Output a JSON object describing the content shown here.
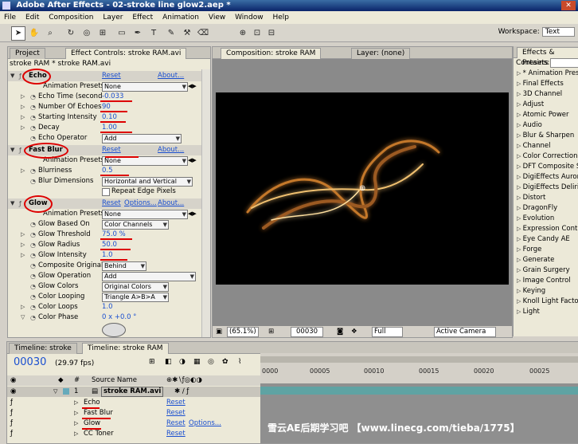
{
  "app": {
    "title": "Adobe After Effects - 02-stroke line glow2.aep *"
  },
  "menu": [
    "File",
    "Edit",
    "Composition",
    "Layer",
    "Effect",
    "Animation",
    "View",
    "Window",
    "Help"
  ],
  "toolbar": {
    "workspace_label": "Workspace:",
    "workspace_value": "Text"
  },
  "effect_controls": {
    "tabs": [
      "Project",
      "Effect Controls: stroke RAM.avi"
    ],
    "subtitle": "stroke RAM * stroke RAM.avi",
    "reset_label": "Reset",
    "about_label": "About...",
    "options_label": "Options...",
    "echo": {
      "name": "Echo",
      "animation_presets_label": "Animation Presets:",
      "animation_presets_value": "None",
      "props": [
        {
          "label": "Echo Time (second",
          "value": "-0.033"
        },
        {
          "label": "Number Of Echoes",
          "value": "90"
        },
        {
          "label": "Starting Intensity",
          "value": "0.10"
        },
        {
          "label": "Decay",
          "value": "1.00"
        }
      ],
      "operator_label": "Echo Operator",
      "operator_value": "Add"
    },
    "fast_blur": {
      "name": "Fast Blur",
      "animation_presets_label": "Animation Presets:",
      "animation_presets_value": "None",
      "blurriness_label": "Blurriness",
      "blurriness_value": "0.5",
      "dimensions_label": "Blur Dimensions",
      "dimensions_value": "Horizontal and Vertical",
      "repeat_label": "Repeat Edge Pixels"
    },
    "glow": {
      "name": "Glow",
      "animation_presets_label": "Animation Presets:",
      "animation_presets_value": "None",
      "based_on_label": "Glow Based On",
      "based_on_value": "Color Channels",
      "threshold_label": "Glow Threshold",
      "threshold_value": "75.0 %",
      "radius_label": "Glow Radius",
      "radius_value": "50.0",
      "intensity_label": "Glow Intensity",
      "intensity_value": "1.0",
      "composite_label": "Composite Original",
      "composite_value": "Behind",
      "operation_label": "Glow Operation",
      "operation_value": "Add",
      "colors_label": "Glow Colors",
      "colors_value": "Original Colors",
      "looping_label": "Color Looping",
      "looping_value": "Triangle A>B>A",
      "loops_label": "Color Loops",
      "loops_value": "1.0",
      "phase_label": "Color Phase",
      "phase_value": "0 x +0.0 °"
    }
  },
  "composition": {
    "tab": "Composition: stroke RAM",
    "layer_tab": "Layer: (none)",
    "zoom": "(65.1%)",
    "timecode": "00030",
    "resolution": "Full",
    "camera": "Active Camera"
  },
  "effects_presets": {
    "tab": "Effects & Presets",
    "contains_label": "Contains:",
    "categories": [
      "* Animation Presets",
      "Final Effects",
      "3D Channel",
      "Adjust",
      "Atomic Power",
      "Audio",
      "Blur & Sharpen",
      "Channel",
      "Color Correction",
      "DFT Composite Suite",
      "DigiEffects Aurorix",
      "DigiEffects Delirium",
      "Distort",
      "DragonFly",
      "Evolution",
      "Expression Controls",
      "Eye Candy AE",
      "Forge",
      "Generate",
      "Grain Surgery",
      "Image Control",
      "Keying",
      "Knoll Light Factory",
      "Light"
    ]
  },
  "timeline": {
    "tabs": [
      "Timeline: stroke",
      "Timeline: stroke RAM"
    ],
    "timecode": "00030",
    "fps": "(29.97 fps)",
    "source_name_header": "Source Name",
    "hash_header": "#",
    "ruler_ticks": [
      "0000",
      "00005",
      "00010",
      "00015",
      "00020",
      "00025"
    ],
    "layer_index": "1",
    "layer_name": "stroke RAM.avi",
    "effects": [
      {
        "name": "Echo",
        "link": "Reset"
      },
      {
        "name": "Fast Blur",
        "link": "Reset"
      },
      {
        "name": "Glow",
        "link": "Reset",
        "extra": "Options..."
      },
      {
        "name": "CC Toner",
        "link": "Reset"
      }
    ]
  },
  "watermark": "雪云AE后期学习吧  【www.linecg.com/tieba/1775】"
}
